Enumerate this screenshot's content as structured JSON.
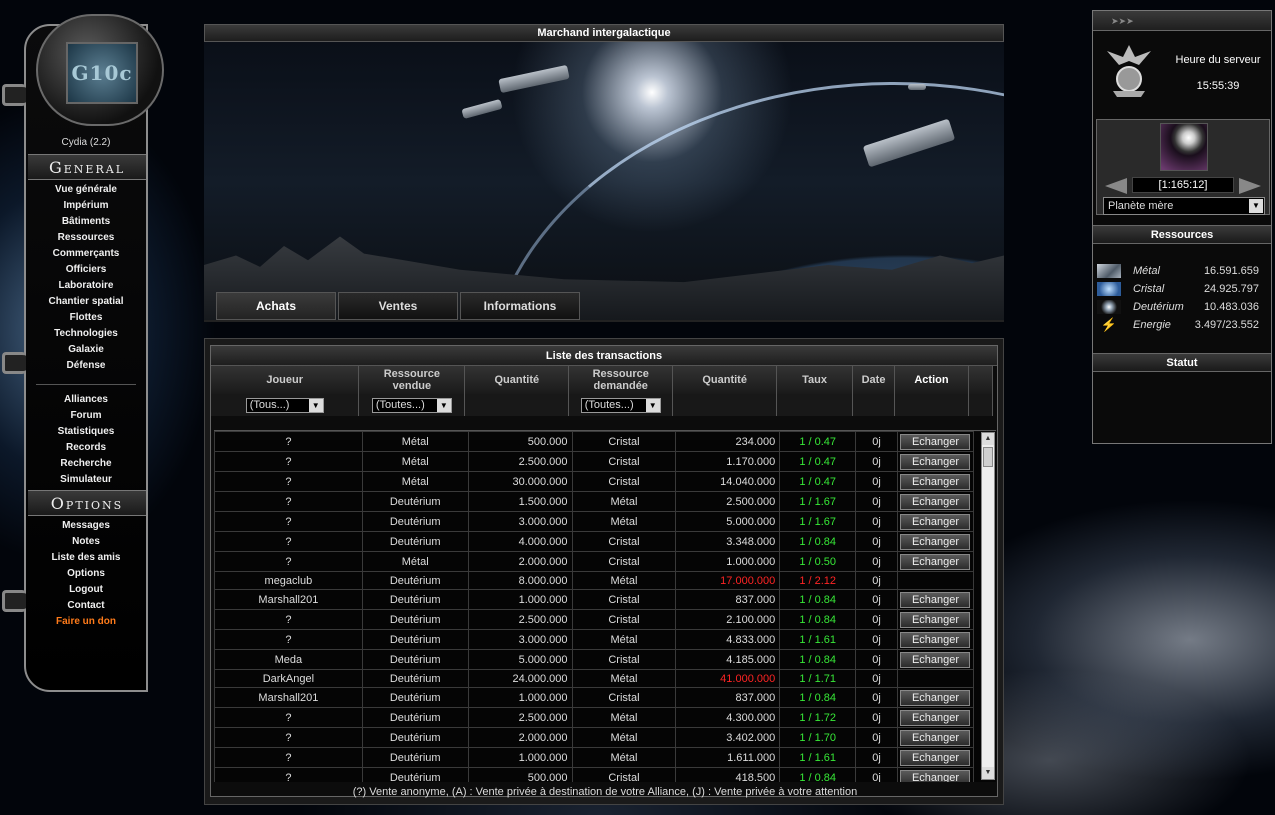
{
  "left_menu": {
    "logo_text": "G10c",
    "version": "Cydia (2.2)",
    "general_title": "General",
    "general_items": [
      "Vue générale",
      "Impérium",
      "Bâtiments",
      "Ressources",
      "Commerçants",
      "Officiers",
      "Laboratoire",
      "Chantier spatial",
      "Flottes",
      "Technologies",
      "Galaxie",
      "Défense"
    ],
    "community_items": [
      "Alliances",
      "Forum",
      "Statistiques",
      "Records",
      "Recherche",
      "Simulateur"
    ],
    "options_title": "Options",
    "options_items": [
      "Messages",
      "Notes",
      "Liste des amis",
      "Options",
      "Logout",
      "Contact"
    ],
    "donate": "Faire un don"
  },
  "center": {
    "title": "Marchand intergalactique",
    "tabs": [
      "Achats",
      "Ventes",
      "Informations"
    ],
    "active_tab": "Achats"
  },
  "table": {
    "title": "Liste des transactions",
    "headers": [
      "Joueur",
      "Ressource vendue",
      "Quantité",
      "Ressource demandée",
      "Quantité",
      "Taux",
      "Date",
      "Action"
    ],
    "filters": {
      "player": "(Tous...)",
      "sold": "(Toutes...)",
      "requested": "(Toutes...)"
    },
    "button_label": "Echanger",
    "rows": [
      {
        "player": "?",
        "sold": "Métal",
        "qty": "500.000",
        "req": "Cristal",
        "req_qty": "234.000",
        "rate": "1 / 0.47",
        "date": "0j",
        "action": true
      },
      {
        "player": "?",
        "sold": "Métal",
        "qty": "2.500.000",
        "req": "Cristal",
        "req_qty": "1.170.000",
        "rate": "1 / 0.47",
        "date": "0j",
        "action": true
      },
      {
        "player": "?",
        "sold": "Métal",
        "qty": "30.000.000",
        "req": "Cristal",
        "req_qty": "14.040.000",
        "rate": "1 / 0.47",
        "date": "0j",
        "action": true
      },
      {
        "player": "?",
        "sold": "Deutérium",
        "qty": "1.500.000",
        "req": "Métal",
        "req_qty": "2.500.000",
        "rate": "1 / 1.67",
        "date": "0j",
        "action": true
      },
      {
        "player": "?",
        "sold": "Deutérium",
        "qty": "3.000.000",
        "req": "Métal",
        "req_qty": "5.000.000",
        "rate": "1 / 1.67",
        "date": "0j",
        "action": true
      },
      {
        "player": "?",
        "sold": "Deutérium",
        "qty": "4.000.000",
        "req": "Cristal",
        "req_qty": "3.348.000",
        "rate": "1 / 0.84",
        "date": "0j",
        "action": true
      },
      {
        "player": "?",
        "sold": "Métal",
        "qty": "2.000.000",
        "req": "Cristal",
        "req_qty": "1.000.000",
        "rate": "1 / 0.50",
        "date": "0j",
        "action": true
      },
      {
        "player": "megaclub",
        "sold": "Deutérium",
        "qty": "8.000.000",
        "req": "Métal",
        "req_qty": "17.000.000",
        "rate": "1 / 2.12",
        "date": "0j",
        "action": false,
        "red": true
      },
      {
        "player": "Marshall201",
        "sold": "Deutérium",
        "qty": "1.000.000",
        "req": "Cristal",
        "req_qty": "837.000",
        "rate": "1 / 0.84",
        "date": "0j",
        "action": true
      },
      {
        "player": "?",
        "sold": "Deutérium",
        "qty": "2.500.000",
        "req": "Cristal",
        "req_qty": "2.100.000",
        "rate": "1 / 0.84",
        "date": "0j",
        "action": true
      },
      {
        "player": "?",
        "sold": "Deutérium",
        "qty": "3.000.000",
        "req": "Métal",
        "req_qty": "4.833.000",
        "rate": "1 / 1.61",
        "date": "0j",
        "action": true
      },
      {
        "player": "Meda",
        "sold": "Deutérium",
        "qty": "5.000.000",
        "req": "Cristal",
        "req_qty": "4.185.000",
        "rate": "1 / 0.84",
        "date": "0j",
        "action": true
      },
      {
        "player": "DarkAngel",
        "sold": "Deutérium",
        "qty": "24.000.000",
        "req": "Métal",
        "req_qty": "41.000.000",
        "rate": "1 / 1.71",
        "date": "0j",
        "action": false,
        "red_qty": true
      },
      {
        "player": "Marshall201",
        "sold": "Deutérium",
        "qty": "1.000.000",
        "req": "Cristal",
        "req_qty": "837.000",
        "rate": "1 / 0.84",
        "date": "0j",
        "action": true
      },
      {
        "player": "?",
        "sold": "Deutérium",
        "qty": "2.500.000",
        "req": "Métal",
        "req_qty": "4.300.000",
        "rate": "1 / 1.72",
        "date": "0j",
        "action": true
      },
      {
        "player": "?",
        "sold": "Deutérium",
        "qty": "2.000.000",
        "req": "Métal",
        "req_qty": "3.402.000",
        "rate": "1 / 1.70",
        "date": "0j",
        "action": true
      },
      {
        "player": "?",
        "sold": "Deutérium",
        "qty": "1.000.000",
        "req": "Métal",
        "req_qty": "1.611.000",
        "rate": "1 / 1.61",
        "date": "0j",
        "action": true
      },
      {
        "player": "?",
        "sold": "Deutérium",
        "qty": "500.000",
        "req": "Cristal",
        "req_qty": "418.500",
        "rate": "1 / 0.84",
        "date": "0j",
        "action": true
      }
    ],
    "legend": "(?) Vente anonyme, (A) : Vente privée à destination de votre Alliance, (J) : Vente privée à votre attention"
  },
  "right_panel": {
    "server_time_label": "Heure du serveur",
    "server_time": "15:55:39",
    "coords": "[1:165:12]",
    "planet_select": "Planète mère",
    "resources_title": "Ressources",
    "resources": [
      {
        "name": "Métal",
        "value": "16.591.659"
      },
      {
        "name": "Cristal",
        "value": "24.925.797"
      },
      {
        "name": "Deutérium",
        "value": "10.483.036"
      },
      {
        "name": "Energie",
        "value": "3.497/23.552"
      }
    ],
    "status_title": "Statut"
  },
  "colors": {
    "green_rate": "#37e837",
    "red_value": "#ff2424",
    "donate": "#ff7b1a"
  }
}
